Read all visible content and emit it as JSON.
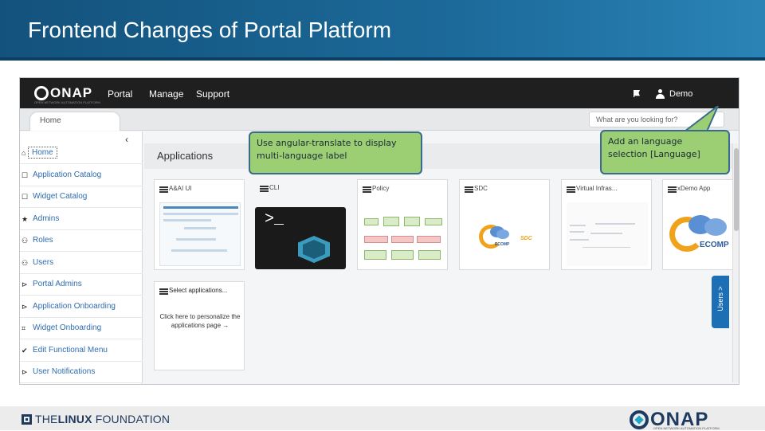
{
  "slide": {
    "title": "Frontend Changes of Portal Platform"
  },
  "portal": {
    "logo_text": "ONAP",
    "logo_sub": "OPEN NETWORK AUTOMATION PLATFORM",
    "nav": [
      "Portal",
      "Manage",
      "Support"
    ],
    "user": "Demo",
    "home_tab": "Home",
    "search_placeholder": "What are you looking for?",
    "collapse_icon": "chevron-left-icon"
  },
  "sidebar": {
    "items": [
      {
        "label": "Home",
        "icon": "home-icon",
        "glyph": "⌂"
      },
      {
        "label": "Application Catalog",
        "icon": "app-catalog-icon",
        "glyph": "☐"
      },
      {
        "label": "Widget Catalog",
        "icon": "widget-catalog-icon",
        "glyph": "☐"
      },
      {
        "label": "Admins",
        "icon": "star-icon",
        "glyph": "★"
      },
      {
        "label": "Roles",
        "icon": "roles-icon",
        "glyph": "⚇"
      },
      {
        "label": "Users",
        "icon": "users-icon",
        "glyph": "⚇"
      },
      {
        "label": "Portal Admins",
        "icon": "portal-admins-icon",
        "glyph": "⊳"
      },
      {
        "label": "Application Onboarding",
        "icon": "onboarding-icon",
        "glyph": "⊳"
      },
      {
        "label": "Widget Onboarding",
        "icon": "widget-onboarding-icon",
        "glyph": "⌗"
      },
      {
        "label": "Edit Functional Menu",
        "icon": "check-icon",
        "glyph": "✔"
      },
      {
        "label": "User Notifications",
        "icon": "notifications-icon",
        "glyph": "⊳"
      }
    ]
  },
  "applications": {
    "title": "Applications",
    "cards": [
      {
        "name": "A&AI UI"
      },
      {
        "name": "CLI"
      },
      {
        "name": "Policy"
      },
      {
        "name": "SDC"
      },
      {
        "name": "Virtual Infras..."
      },
      {
        "name": "xDemo App"
      }
    ],
    "cli_prompt": ">_",
    "ecomp_label": "ECOMP",
    "sdc_label": "SDC",
    "select_card": {
      "name": "Select applications...",
      "text": "Click here to personalize the applications page →"
    },
    "users_tab": "Users >"
  },
  "callouts": {
    "left": "Use angular-translate to display multi-language label",
    "right": "Add an language selection [Language]"
  },
  "footer": {
    "linux_a": "THE",
    "linux_b": "LINUX",
    "linux_c": " FOUNDATION",
    "onap": "ONAP",
    "onap_sub": "OPEN NETWORK AUTOMATION PLATFORM"
  },
  "colors": {
    "title_bar": "#1c6a9a",
    "callout_fill": "#9ccf74",
    "callout_border": "#3a6b8c",
    "link_blue": "#2f6cae",
    "users_tab": "#1d6fb5"
  }
}
